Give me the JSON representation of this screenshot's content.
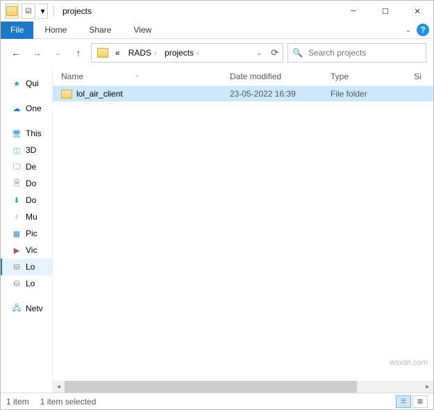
{
  "title": "projects",
  "ribbon": {
    "file": "File",
    "tabs": [
      "Home",
      "Share",
      "View"
    ]
  },
  "breadcrumb": {
    "prefix": "«",
    "items": [
      "RADS",
      "projects"
    ]
  },
  "search": {
    "placeholder": "Search projects"
  },
  "columns": {
    "name": "Name",
    "date": "Date modified",
    "type": "Type",
    "size": "Si"
  },
  "files": [
    {
      "name": "lol_air_client",
      "date": "23-05-2022 16:39",
      "type": "File folder",
      "selected": true
    }
  ],
  "sidebar": {
    "quick": "Qui",
    "onedrive": "One",
    "thispc": "This",
    "items": [
      "3D",
      "De",
      "Do",
      "Do",
      "Mu",
      "Pic",
      "Vic",
      "Lo",
      "Lo"
    ],
    "network": "Netv"
  },
  "status": {
    "count": "1 item",
    "selected": "1 item selected"
  },
  "watermark": "wsxdn.com"
}
